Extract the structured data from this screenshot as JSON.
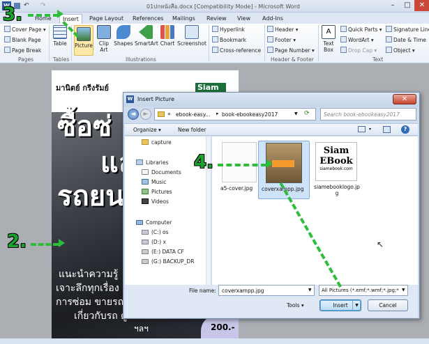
{
  "window": {
    "title": "01ปกหนังสือ.docx [Compatibility Mode] - Microsoft Word"
  },
  "tabs": [
    "Home",
    "Insert",
    "Page Layout",
    "References",
    "Mailings",
    "Review",
    "View",
    "Add-Ins"
  ],
  "ribbon": {
    "pages": {
      "cover_page": "Cover Page",
      "blank_page": "Blank Page",
      "page_break": "Page Break",
      "label": "Pages"
    },
    "tables": {
      "table": "Table",
      "label": "Tables"
    },
    "illustrations": {
      "picture": "Picture",
      "clip_art": "Clip Art",
      "shapes": "Shapes",
      "smartart": "SmartArt",
      "chart": "Chart",
      "screenshot": "Screenshot",
      "label": "Illustrations"
    },
    "links": {
      "hyperlink": "Hyperlink",
      "bookmark": "Bookmark",
      "cross_reference": "Cross-reference"
    },
    "header_footer": {
      "header": "Header",
      "footer": "Footer",
      "page_number": "Page Number",
      "label": "Header & Footer"
    },
    "text": {
      "text_box": "Text Box",
      "quick_parts": "Quick Parts",
      "wordart": "WordArt",
      "drop_cap": "Drop Cap",
      "signature_line": "Signature Line",
      "date_time": "Date & Time",
      "object": "Object",
      "label": "Text"
    }
  },
  "doc": {
    "author": "มานิตย์ กรีงรัมย์",
    "logo_frag": "Siam",
    "line1": "ซื้อซ่",
    "line2": "แล",
    "line3": "รถยน",
    "text1": "แนะนำความรู้",
    "text2": "เจาะลึกทุกเรื่อง",
    "text3": "การซ่อม ขายรถ",
    "text4": "เกี่ยวกับรถ ดูแล",
    "text5": "ฯลฯ",
    "price": "200.-"
  },
  "dialog": {
    "title": "Insert Picture",
    "breadcrumb": [
      "«",
      "ebook-easy...",
      "book-ebookeasy2017"
    ],
    "search_placeholder": "Search book-ebookeasy2017",
    "organize": "Organize",
    "new_folder": "New folder",
    "nav": {
      "capture": "capture",
      "libraries": "Libraries",
      "documents": "Documents",
      "music": "Music",
      "pictures": "Pictures",
      "videos": "Videos",
      "computer": "Computer",
      "c_drive": "(C:) os",
      "d_drive": "(D:) x",
      "e_drive": "(E:) DATA CF",
      "g_drive": "(G:) BACKUP_DR"
    },
    "files": [
      {
        "name": "a5-cover.jpg"
      },
      {
        "name": "coverxampp.jpg"
      },
      {
        "name": "siamebooklogo.jpg"
      }
    ],
    "thumb_logo": {
      "line1": "Siam",
      "line2": "EBook",
      "line3": "siamebook.com"
    },
    "file_name_label": "File name:",
    "file_name_value": "coverxampp.jpg",
    "file_type": "All Pictures (*.emf;*.wmf;*.jpg;*",
    "tools": "Tools",
    "insert": "Insert",
    "cancel": "Cancel"
  },
  "annotations": {
    "step2": "2.",
    "step3": "3.",
    "step4": "4."
  }
}
